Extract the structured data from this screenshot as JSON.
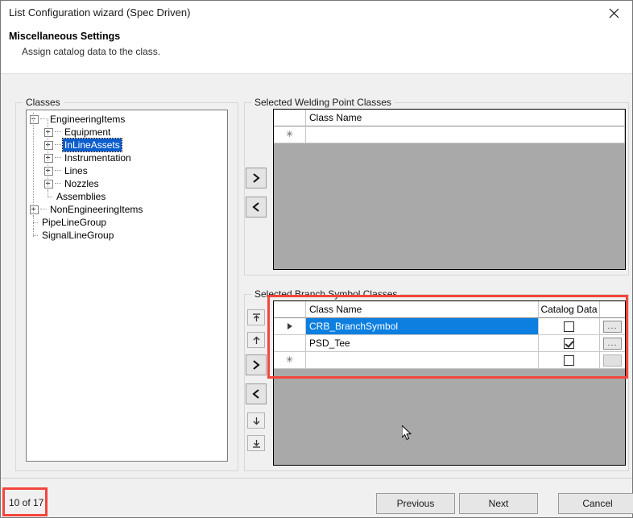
{
  "window": {
    "title": "List Configuration wizard (Spec Driven)",
    "close_icon": "close-icon",
    "header_title": "Miscellaneous Settings",
    "header_subtitle": "Assign catalog data to the class."
  },
  "classes_panel": {
    "legend": "Classes",
    "tree": [
      {
        "label": "EngineeringItems",
        "depth": 0,
        "toggle": "minus",
        "selected": false
      },
      {
        "label": "Equipment",
        "depth": 1,
        "toggle": "plus",
        "selected": false
      },
      {
        "label": "InLineAssets",
        "depth": 1,
        "toggle": "plus",
        "selected": true
      },
      {
        "label": "Instrumentation",
        "depth": 1,
        "toggle": "plus",
        "selected": false
      },
      {
        "label": "Lines",
        "depth": 1,
        "toggle": "plus",
        "selected": false
      },
      {
        "label": "Nozzles",
        "depth": 1,
        "toggle": "plus",
        "selected": false
      },
      {
        "label": "Assemblies",
        "depth": 1,
        "toggle": "leaf",
        "selected": false
      },
      {
        "label": "NonEngineeringItems",
        "depth": 0,
        "toggle": "plus",
        "selected": false
      },
      {
        "label": "PipeLineGroup",
        "depth": 0,
        "toggle": "leaf",
        "selected": false
      },
      {
        "label": "SignalLineGroup",
        "depth": 0,
        "toggle": "leaf",
        "selected": false
      }
    ]
  },
  "welding_panel": {
    "legend": "Selected Welding Point Classes",
    "columns": [
      "",
      "Class Name"
    ],
    "rows": [
      {
        "indicator": "new-row-asterisk",
        "class_name": ""
      }
    ],
    "buttons": [
      {
        "name": "move-right-button",
        "icon": "chevron-right-icon"
      },
      {
        "name": "move-left-button",
        "icon": "chevron-left-icon"
      }
    ]
  },
  "branch_panel": {
    "legend": "Selected Branch Symbol Classes",
    "columns": [
      "",
      "Class Name",
      "Catalog Data",
      ""
    ],
    "rows": [
      {
        "indicator": "current-row-arrow",
        "class_name": "CRB_BranchSymbol",
        "catalog_data": false,
        "selected": true,
        "ellipsis": "...",
        "ellipsis_enabled": true
      },
      {
        "indicator": "",
        "class_name": "PSD_Tee",
        "catalog_data": true,
        "selected": false,
        "ellipsis": "...",
        "ellipsis_enabled": true
      },
      {
        "indicator": "new-row-asterisk",
        "class_name": "",
        "catalog_data": false,
        "selected": false,
        "ellipsis": "",
        "ellipsis_enabled": false
      }
    ],
    "buttons": [
      {
        "name": "move-to-top-button",
        "icon": "double-up-arrow-icon"
      },
      {
        "name": "move-up-button",
        "icon": "up-arrow-icon"
      },
      {
        "name": "move-right-button",
        "icon": "chevron-right-icon"
      },
      {
        "name": "move-left-button",
        "icon": "chevron-left-icon"
      },
      {
        "name": "move-down-button",
        "icon": "down-arrow-icon"
      },
      {
        "name": "move-to-bottom-button",
        "icon": "double-down-arrow-icon"
      }
    ]
  },
  "footer": {
    "page_count": "10 of 17",
    "previous_label": "Previous",
    "next_label": "Next",
    "cancel_label": "Cancel"
  },
  "annotations": {
    "highlight_color": "#f4453c",
    "selection_color": "#0c7fe0",
    "tree_selection_color": "#0c5ecc"
  }
}
